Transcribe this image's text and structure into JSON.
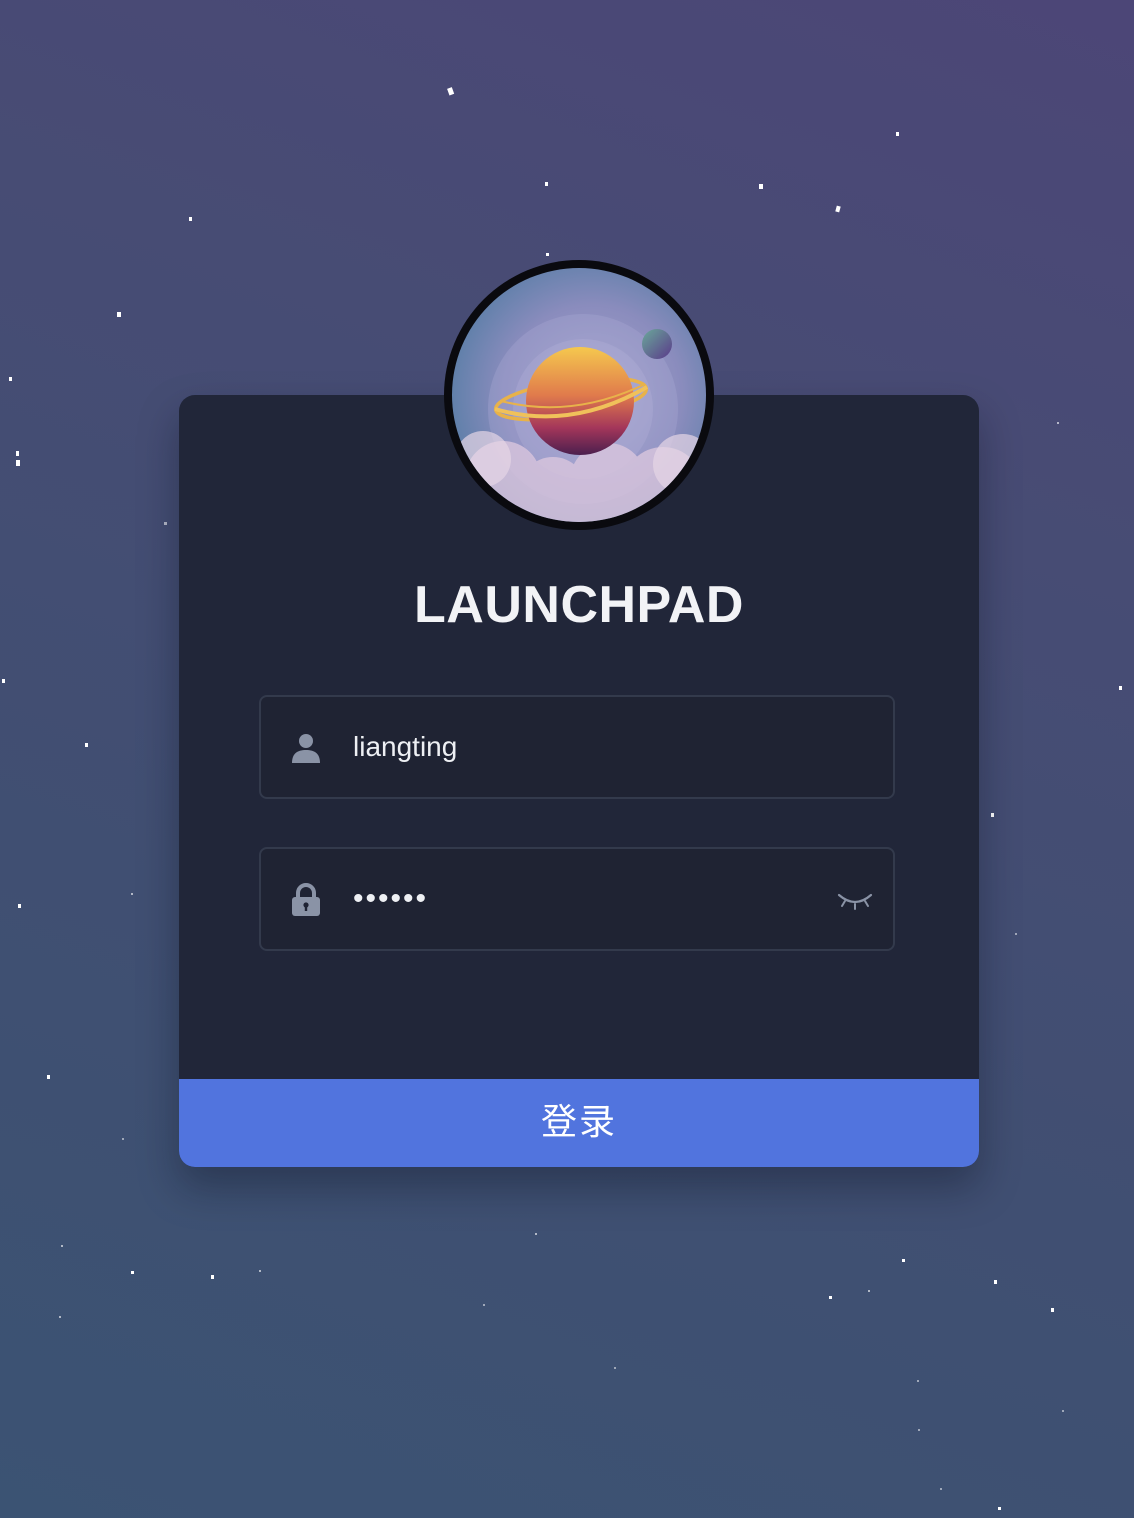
{
  "app": {
    "title": "LAUNCHPAD"
  },
  "login_form": {
    "username": {
      "value": "liangting",
      "icon": "user-icon"
    },
    "password": {
      "masked_value": "••••••",
      "icon": "lock-icon",
      "toggle_icon": "eye-closed-icon"
    },
    "submit_label": "登录"
  },
  "logo": {
    "icon": "planet-logo"
  },
  "colors": {
    "background_top": "#4c4677",
    "background_bottom": "#3b5373",
    "card": "#212639",
    "button": "#5174de",
    "text": "#f2f3f6",
    "icon_muted": "#8a93a6"
  }
}
